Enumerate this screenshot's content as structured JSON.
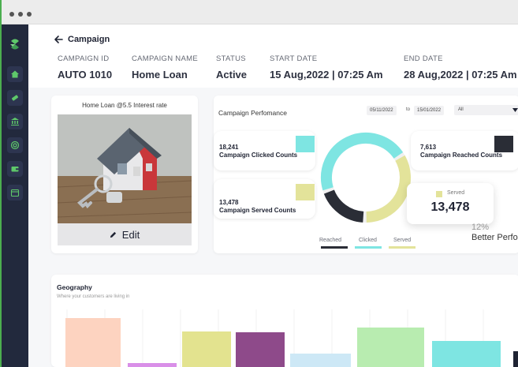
{
  "header": {
    "title": "Campaign",
    "meta": [
      {
        "label": "CAMPAIGN ID",
        "value": "AUTO 1010"
      },
      {
        "label": "CAMPAIGN NAME",
        "value": "Home Loan"
      },
      {
        "label": "STATUS",
        "value": "Active"
      },
      {
        "label": "START DATE",
        "value": "15 Aug,2022 | 07:25 Am"
      },
      {
        "label": "END DATE",
        "value": "28 Aug,2022 | 07:25 Am"
      }
    ]
  },
  "sidebar": {
    "items": [
      {
        "icon": "home-icon"
      },
      {
        "icon": "ticket-icon"
      },
      {
        "icon": "bank-icon"
      },
      {
        "icon": "target-icon"
      },
      {
        "icon": "wallet-icon"
      },
      {
        "icon": "calendar-icon"
      }
    ]
  },
  "campaign_card": {
    "title": "Home Loan @5.5 Interest rate",
    "edit_label": "Edit"
  },
  "performance": {
    "title": "Campaign Perfomance",
    "start_date": "05/11/2022",
    "to_label": "to",
    "end_date": "15/01/2022",
    "filter_value": "All",
    "stats": [
      {
        "value": "18,241",
        "label": "Campaign Clicked Counts",
        "color": "#7ee5e2"
      },
      {
        "value": "7,613",
        "label": "Campaign Reached Counts",
        "color": "#2a2d36"
      },
      {
        "value": "13,478",
        "label": "Campaign Served Counts",
        "color": "#e3e39a"
      }
    ],
    "legend": [
      {
        "label": "Reached",
        "color": "#2a2d36"
      },
      {
        "label": "Clicked",
        "color": "#7ee5e2"
      },
      {
        "label": "Served",
        "color": "#e3e39a"
      }
    ],
    "donut_values": {
      "reached": 7613,
      "clicked": 18241,
      "served": 13478
    },
    "tooltip": {
      "label": "Served",
      "value": "13,478"
    },
    "better_pct": "12%",
    "better_text": "Better Perfo"
  },
  "geography": {
    "title": "Geography",
    "subtitle": "Where your customers are living in",
    "bar_colors": [
      "#fdd3c0",
      "#d98fe8",
      "#e3e38f",
      "#8e4a8a",
      "#cde8f6",
      "#b8ecb0",
      "#7ee5e2",
      "#1f2333"
    ],
    "bar_levels": [
      0.62,
      0.05,
      0.45,
      0.44,
      0.17,
      0.5,
      0.33,
      0.2
    ]
  },
  "colors": {
    "sidebar": "#22293d",
    "accent_green": "#4cae4f"
  }
}
